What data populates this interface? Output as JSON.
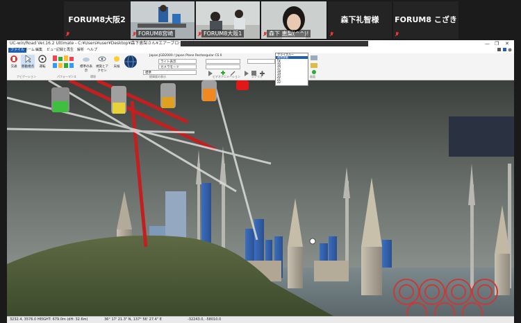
{
  "zoom": {
    "tiles": [
      {
        "name": "FORUM8大阪2",
        "kind": "name"
      },
      {
        "label": "FORUM8宮崎",
        "kind": "video"
      },
      {
        "label": "FORUM8大阪1",
        "kind": "video"
      },
      {
        "label": "森下 恵梨(^^)!",
        "kind": "video"
      },
      {
        "name": "森下礼智様",
        "kind": "name"
      },
      {
        "name": "FORUM8 こざき",
        "kind": "name"
      }
    ]
  },
  "app": {
    "title": "UC-win/Road Ver.16.2 Ultimate - C:¥Users¥user¥Desktop¥森下恵梨さん¥エアーブロックの大きさ.rd - Wiiファイル",
    "window_controls": [
      "—",
      "❐",
      "✕"
    ],
    "menu": [
      "ファイル",
      "ホーム",
      "編集",
      "ビュー",
      "記録と再生",
      "解析",
      "ヘルプ"
    ],
    "ribbon": {
      "buttons": [
        {
          "label": "交通",
          "name": "traffic-button"
        },
        {
          "label": "移動視点",
          "name": "moving-viewpoint-button"
        },
        {
          "label": "運転",
          "name": "drive-button"
        },
        {
          "label": "標準の表示",
          "name": "standard-view-button"
        },
        {
          "label": "視覚とアクセシ",
          "name": "visual-access-button"
        },
        {
          "label": "天候",
          "name": "weather-button"
        }
      ],
      "group_labels": [
        "ナビゲーション",
        "パフォーマンス",
        "環境",
        "経緯度の表示",
        "ビデオアニメーション",
        "シナリオ",
        "画面"
      ],
      "coord_header": "Japan  JGD2000 / Japan Plane Rectangular CS II",
      "selects": [
        {
          "label": "ライト表示",
          "value": "なし"
        },
        {
          "label": "カメラモード",
          "value": ""
        },
        {
          "label": "標準",
          "value": ""
        }
      ],
      "dropdown_items": [
        "フライスルー",
        "通常移動",
        "fly",
        "15",
        "16",
        "17",
        "18",
        "19",
        "20",
        "21",
        "22",
        "23"
      ]
    },
    "status": {
      "left": "3232.4, 3576.0  HEIGHT: 679.0m (dH: 32.6m)",
      "mid": "36° 17' 21.3\" N, 137° 56' 27.4\" E",
      "right": "-32243.0, -58010.0"
    }
  }
}
